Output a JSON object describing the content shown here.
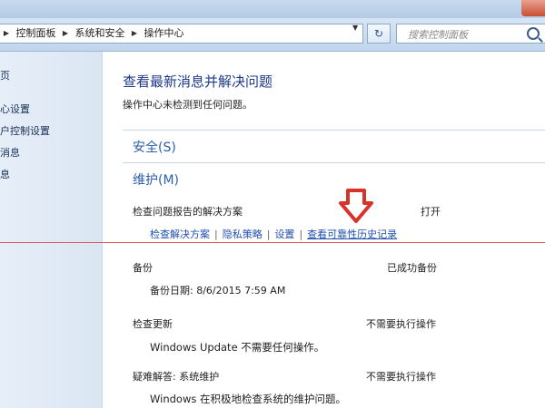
{
  "address_bar": {
    "breadcrumbs": [
      "控制面板",
      "系统和安全",
      "操作中心"
    ],
    "search_placeholder": "搜索控制面板",
    "refresh_glyph": "↻",
    "dropdown_glyph": "▼"
  },
  "left_nav": {
    "items": [
      "页",
      "心设置",
      "户控制设置",
      "消息",
      "息"
    ]
  },
  "main": {
    "title": "查看最新消息并解决问题",
    "subtitle": "操作中心未检测到任何问题。",
    "sections": {
      "security": "安全(S)",
      "maintenance": "维护(M)"
    },
    "problem_reports": {
      "label": "检查问题报告的解决方案",
      "status": "打开",
      "links": [
        "检查解决方案",
        "隐私策略",
        "设置",
        "查看可靠性历史记录"
      ]
    },
    "backup": {
      "label": "备份",
      "status": "已成功备份",
      "detail": "备份日期: 8/6/2015 7:59 AM"
    },
    "updates": {
      "label": "检查更新",
      "status": "不需要执行操作",
      "detail": "Windows Update 不需要任何操作。"
    },
    "troubleshooting": {
      "label": "疑难解答: 系统维护",
      "status": "不需要执行操作",
      "detail": "Windows 在积极地检查系统的维护问题。"
    }
  },
  "colors": {
    "accent": "#1e3a8a",
    "link": "#1f4fb0",
    "arrow": "#d9322a",
    "highlight_line": "#e35b5b"
  }
}
